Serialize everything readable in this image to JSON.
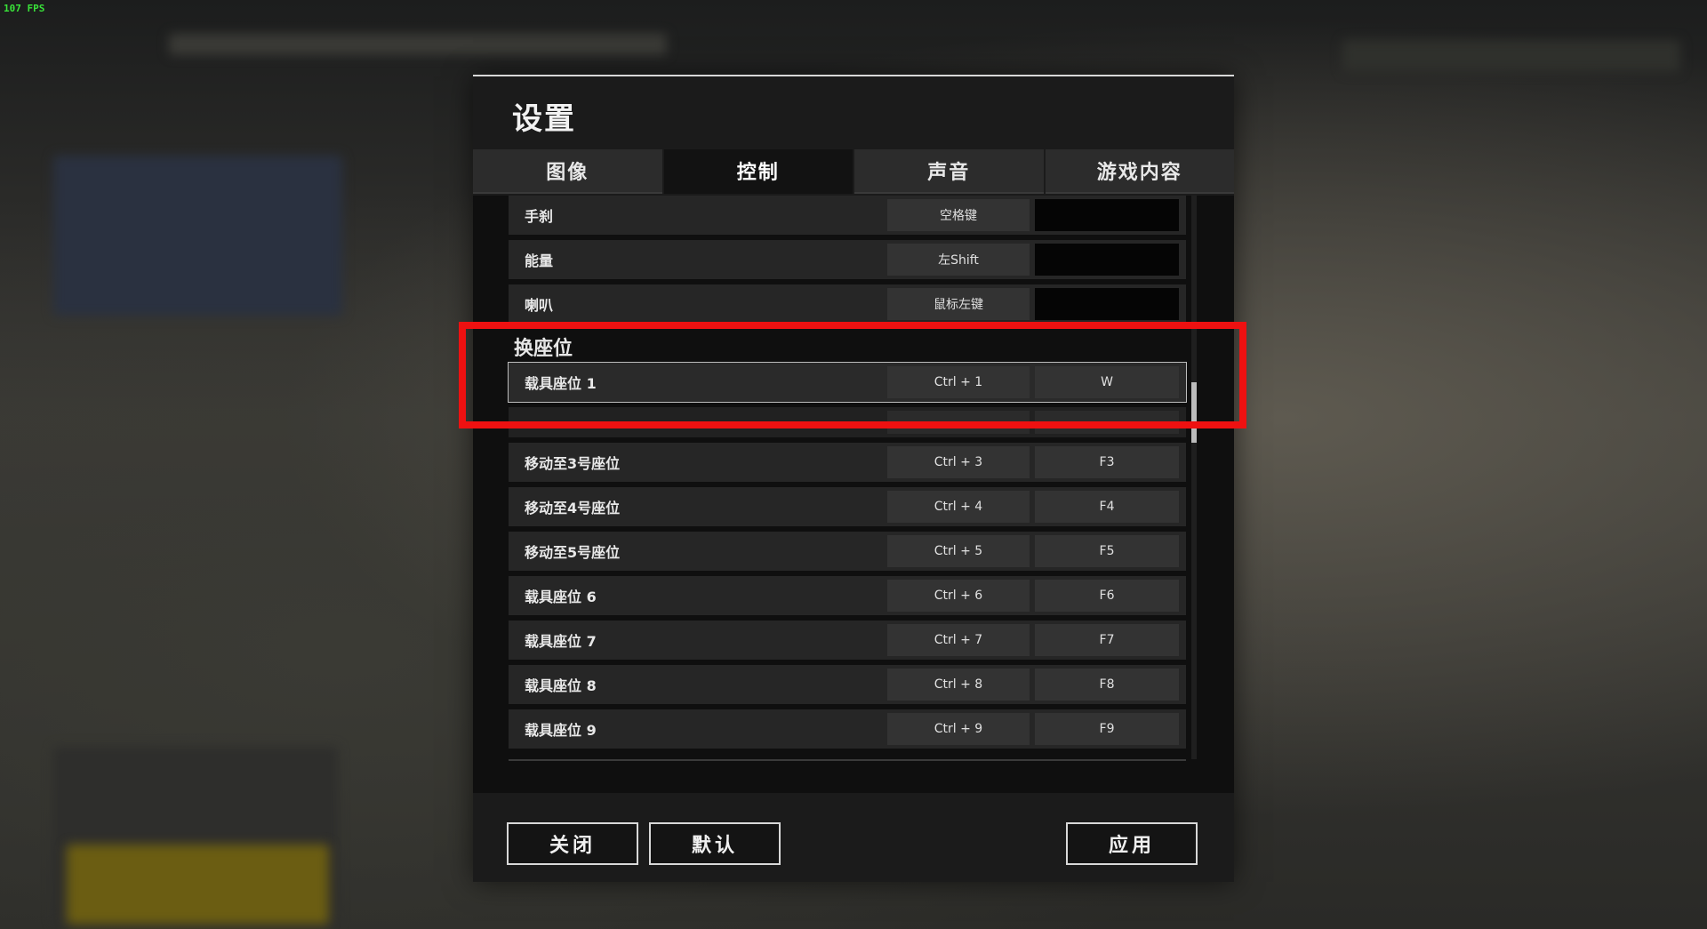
{
  "overlay": {
    "fps": "107 FPS"
  },
  "dialog": {
    "title": "设置",
    "tabs": [
      {
        "label": "图像",
        "active": false
      },
      {
        "label": "控制",
        "active": true
      },
      {
        "label": "声音",
        "active": false
      },
      {
        "label": "游戏内容",
        "active": false
      }
    ],
    "rows_top": [
      {
        "label": "手刹",
        "key1": "空格键",
        "key2": ""
      },
      {
        "label": "能量",
        "key1": "左Shift",
        "key2": ""
      },
      {
        "label": "喇叭",
        "key1": "鼠标左键",
        "key2": ""
      }
    ],
    "section_title": "换座位",
    "rows_seats": [
      {
        "label": "载具座位 1",
        "key1": "Ctrl + 1",
        "key2": "W",
        "selected": true
      },
      {
        "label": "",
        "key1": "",
        "key2": ""
      },
      {
        "label": "移动至3号座位",
        "key1": "Ctrl + 3",
        "key2": "F3"
      },
      {
        "label": "移动至4号座位",
        "key1": "Ctrl + 4",
        "key2": "F4"
      },
      {
        "label": "移动至5号座位",
        "key1": "Ctrl + 5",
        "key2": "F5"
      },
      {
        "label": "载具座位 6",
        "key1": "Ctrl + 6",
        "key2": "F6"
      },
      {
        "label": "载具座位 7",
        "key1": "Ctrl + 7",
        "key2": "F7"
      },
      {
        "label": "载具座位 8",
        "key1": "Ctrl + 8",
        "key2": "F8"
      },
      {
        "label": "载具座位 9",
        "key1": "Ctrl + 9",
        "key2": "F9"
      }
    ],
    "buttons": {
      "close": "关闭",
      "default": "默认",
      "apply": "应用"
    }
  },
  "colors": {
    "highlight": "#ee1111",
    "fps": "#39e339"
  }
}
